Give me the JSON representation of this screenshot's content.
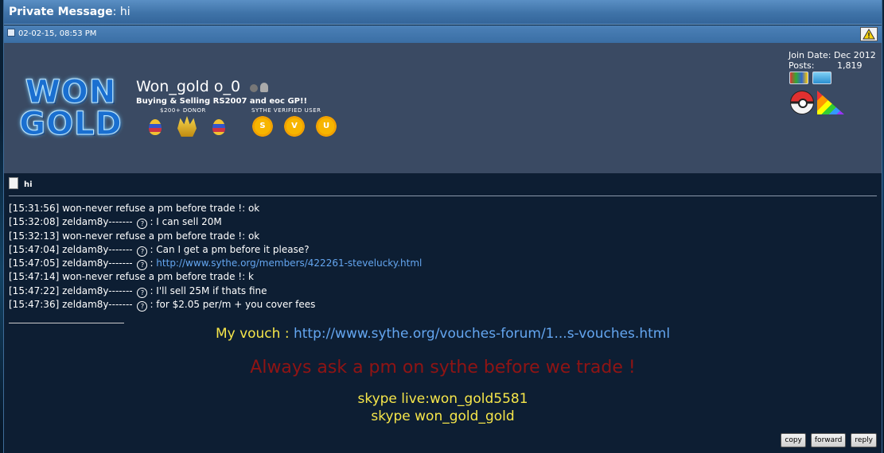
{
  "title": {
    "label": "Private Message",
    "sep": ": ",
    "subject": "hi"
  },
  "post": {
    "datetime": "02-02-15, 08:53 PM"
  },
  "user": {
    "avatar_lines": [
      "WON",
      "GOLD"
    ],
    "name": "Won_gold o_0",
    "title": "Buying & Selling RS2007 and eoc GP!!",
    "badge_labels": [
      "$200+ DONOR",
      "SYTHE VERIFIED USER"
    ],
    "badge_letters": [
      "S",
      "V",
      "U"
    ],
    "join_label": "Join Date:",
    "join_value": "Dec 2012",
    "posts_label": "Posts:",
    "posts_value": "1,819"
  },
  "message": {
    "title": "hi",
    "lines": [
      {
        "time": "[15:31:56]",
        "speaker": "won-never refuse a pm before trade !:",
        "q": false,
        "text": "ok",
        "link": false
      },
      {
        "time": "[15:32:08]",
        "speaker": "zeldam8y-------",
        "q": true,
        "text": ": I can sell 20M",
        "link": false
      },
      {
        "time": "[15:32:13]",
        "speaker": "won-never refuse a pm before trade !:",
        "q": false,
        "text": "ok",
        "link": false
      },
      {
        "time": "[15:47:04]",
        "speaker": "zeldam8y-------",
        "q": true,
        "text": ": Can I get a pm before it please?",
        "link": false
      },
      {
        "time": "[15:47:05]",
        "speaker": "zeldam8y-------",
        "q": true,
        "text": "http://www.sythe.org/members/422261-stevelucky.html",
        "link": true
      },
      {
        "time": "[15:47:14]",
        "speaker": "won-never refuse a pm before trade !:",
        "q": false,
        "text": "k",
        "link": false
      },
      {
        "time": "[15:47:22]",
        "speaker": "zeldam8y-------",
        "q": true,
        "text": ": I'll sell 25M if thats fine",
        "link": false
      },
      {
        "time": "[15:47:36]",
        "speaker": "zeldam8y-------",
        "q": true,
        "text": ": for $2.05 per/m + you cover fees",
        "link": false
      }
    ]
  },
  "signature": {
    "vouch_label": "My vouch : ",
    "vouch_url": "http://www.sythe.org/vouches-forum/1...s-vouches.html",
    "warning": "Always ask a pm on sythe before we trade !",
    "skype1": "skype live:won_gold5581",
    "skype2": "skype won_gold_gold"
  },
  "actions": {
    "copy": "copy",
    "forward": "forward",
    "reply": "reply"
  },
  "colors": {
    "accent_yellow": "#f6e64a",
    "link_blue": "#64a6f0",
    "warning_red": "#8f1414"
  }
}
